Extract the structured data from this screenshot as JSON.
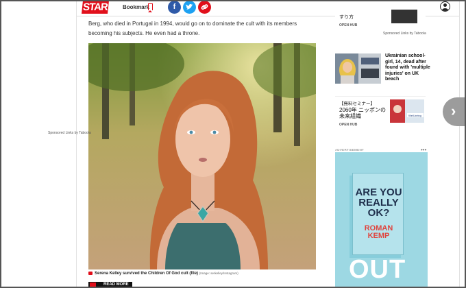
{
  "header": {
    "logo": "STAR",
    "bookmark_label": "Bookmark",
    "share": {
      "facebook": "f",
      "twitter": "t",
      "link": "⊘"
    }
  },
  "article": {
    "paragraph": "Berg, who died in Portugal in 1994, would go on to dominate the cult with its members becoming his subjects. He even had a throne.",
    "caption": "Serena Kelley survived the Children Of God cult (file)",
    "caption_credit": "(Image: serkelley/Instagram)",
    "read_more": "READ MORE"
  },
  "sidebar": {
    "top_card": {
      "text": "すり方",
      "source": "OPEN HUB"
    },
    "sponsored_label_1": "Sponsored Links by Taboola",
    "news": {
      "title": "Ukrainian school-girl, 14, dead after found with 'multiple injuries' on UK beach"
    },
    "ad2": {
      "line1": "【無料セミナー】",
      "line2": "2060年 ニッポンの",
      "line3": "未来組織",
      "source": "OPEN HUB",
      "img_text": "Well-being"
    },
    "sponsored_label_2": "Sponsored Links by Taboola",
    "advertisement_label": "ADVERTISEMENT",
    "book_ad": {
      "title": "ARE YOU REALLY OK?",
      "author": "ROMAN KEMP",
      "bottom": "OUT"
    }
  },
  "colors": {
    "brand_red": "#e10f1b",
    "facebook": "#2f5aa8",
    "twitter": "#1da1f2",
    "ad_bg": "#9dd8e3"
  }
}
